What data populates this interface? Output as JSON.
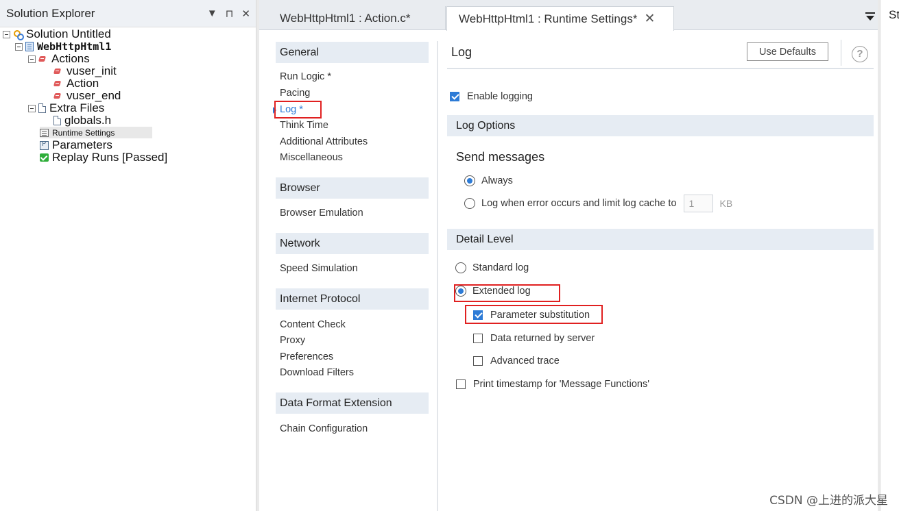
{
  "solution_explorer": {
    "title": "Solution Explorer",
    "controls": {
      "dropdown": "▼",
      "pin": "⊓",
      "close": "✕"
    },
    "tree": {
      "solution": "Solution Untitled",
      "script": "WebHttpHtml1",
      "actions": "Actions",
      "action_items": [
        "vuser_init",
        "Action",
        "vuser_end"
      ],
      "extra_files": "Extra Files",
      "extra_file_items": [
        "globals.h"
      ],
      "runtime_settings": "Runtime Settings",
      "parameters": "Parameters",
      "replay_runs": "Replay Runs [Passed]"
    }
  },
  "tabs": [
    {
      "label": "WebHttpHtml1 : Action.c*"
    },
    {
      "label": "WebHttpHtml1 : Runtime Settings*",
      "close": "✕"
    }
  ],
  "nav": {
    "sections": [
      {
        "title": "General",
        "items": [
          "Run Logic *",
          "Pacing",
          "Log *",
          "Think Time",
          "Additional Attributes",
          "Miscellaneous"
        ]
      },
      {
        "title": "Browser",
        "items": [
          "Browser Emulation"
        ]
      },
      {
        "title": "Network",
        "items": [
          "Speed Simulation"
        ]
      },
      {
        "title": "Internet Protocol",
        "items": [
          "Content Check",
          "Proxy",
          "Preferences",
          "Download Filters"
        ]
      },
      {
        "title": "Data Format Extension",
        "items": [
          "Chain Configuration"
        ]
      }
    ],
    "selected": "Log *"
  },
  "content": {
    "title": "Log",
    "use_defaults": "Use Defaults",
    "help": "?",
    "enable_logging": {
      "label": "Enable logging",
      "checked": true
    },
    "log_options": {
      "title": "Log Options",
      "send_messages": "Send messages",
      "always": {
        "label": "Always",
        "checked": true
      },
      "on_error": {
        "label": "Log when error occurs and limit log cache to",
        "checked": false,
        "value": "1",
        "unit": "KB"
      }
    },
    "detail_level": {
      "title": "Detail Level",
      "standard": {
        "label": "Standard log",
        "checked": false
      },
      "extended": {
        "label": "Extended log",
        "checked": true
      },
      "param_subst": {
        "label": "Parameter substitution",
        "checked": true
      },
      "data_returned": {
        "label": "Data returned by server",
        "checked": false
      },
      "advanced_trace": {
        "label": "Advanced trace",
        "checked": false
      },
      "print_timestamp": {
        "label": "Print timestamp for 'Message Functions'",
        "checked": false
      }
    }
  },
  "right_strip": {
    "title": "St"
  },
  "watermark": "CSDN @上进的派大星",
  "colors": {
    "accent": "#2d7bd6",
    "highlight": "#e02020",
    "section_bg": "#e6ecf3"
  }
}
